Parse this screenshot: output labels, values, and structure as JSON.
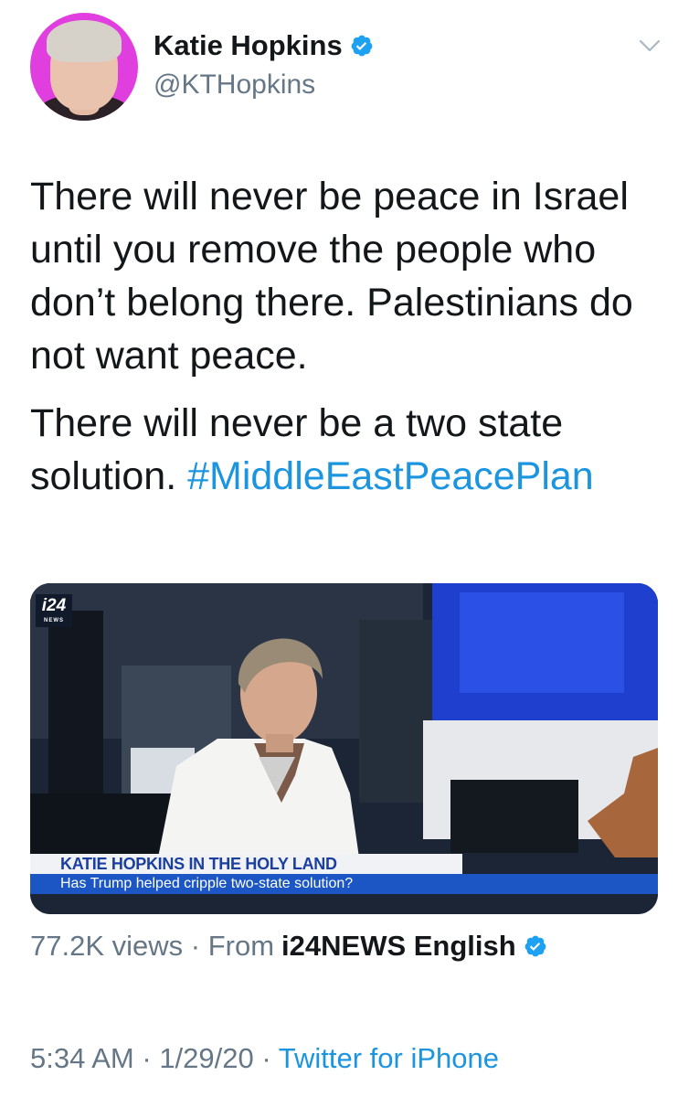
{
  "author": {
    "display_name": "Katie Hopkins",
    "handle": "@KTHopkins",
    "verified_icon": "verified-badge-icon",
    "avatar_bg": "#e13ee0"
  },
  "menu": {
    "icon": "chevron-down-icon"
  },
  "tweet": {
    "paragraph_1": "There will never be peace in Israel until you remove the people who don’t belong there. Palestinians do not want peace.",
    "paragraph_2_text": "There will never be a two state solution. ",
    "hashtag": "#MiddleEastPeacePlan",
    "hashtag_color": "#1b95e0"
  },
  "media": {
    "logo_text": "i24",
    "logo_sub": "NEWS",
    "lower_third_title": "KATIE HOPKINS IN THE HOLY LAND",
    "lower_third_subtitle": "Has Trump helped cripple two-state solution?"
  },
  "stats": {
    "views": "77.2K views",
    "separator": " · ",
    "from_label": "From",
    "source": "i24NEWS English"
  },
  "footer": {
    "time": "5:34 AM",
    "date": "1/29/20",
    "separator": " · ",
    "app": "Twitter for iPhone"
  }
}
